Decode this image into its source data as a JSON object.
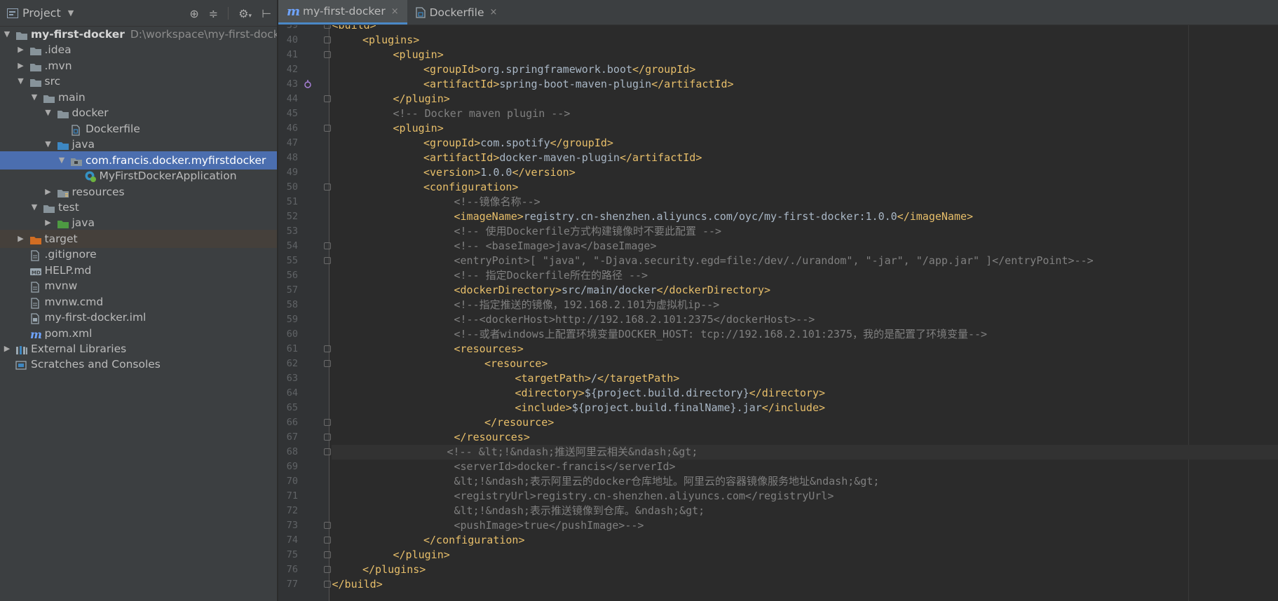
{
  "project_panel": {
    "title": "Project",
    "root_name": "my-first-docker",
    "root_path": "D:\\workspace\\my-first-docker",
    "items": [
      {
        "label": "my-first-docker",
        "depth": 0,
        "arrow": "down",
        "icon": "folder-icon"
      },
      {
        "label": ".idea",
        "depth": 1,
        "arrow": "right",
        "icon": "folder-icon"
      },
      {
        "label": ".mvn",
        "depth": 1,
        "arrow": "right",
        "icon": "folder-icon"
      },
      {
        "label": "src",
        "depth": 1,
        "arrow": "down",
        "icon": "folder-icon"
      },
      {
        "label": "main",
        "depth": 2,
        "arrow": "down",
        "icon": "folder-icon"
      },
      {
        "label": "docker",
        "depth": 3,
        "arrow": "down",
        "icon": "folder-icon"
      },
      {
        "label": "Dockerfile",
        "depth": 4,
        "arrow": "",
        "icon": "dockerfile-icon"
      },
      {
        "label": "java",
        "depth": 3,
        "arrow": "down",
        "icon": "source-folder-icon"
      },
      {
        "label": "com.francis.docker.myfirstdocker",
        "depth": 4,
        "arrow": "down",
        "icon": "package-icon"
      },
      {
        "label": "MyFirstDockerApplication",
        "depth": 5,
        "arrow": "",
        "icon": "spring-class-icon"
      },
      {
        "label": "resources",
        "depth": 3,
        "arrow": "right",
        "icon": "resources-folder-icon"
      },
      {
        "label": "test",
        "depth": 2,
        "arrow": "down",
        "icon": "folder-icon"
      },
      {
        "label": "java",
        "depth": 3,
        "arrow": "right",
        "icon": "test-folder-icon"
      },
      {
        "label": "target",
        "depth": 1,
        "arrow": "right",
        "icon": "excluded-folder-icon"
      },
      {
        "label": ".gitignore",
        "depth": 1,
        "arrow": "",
        "icon": "file-icon"
      },
      {
        "label": "HELP.md",
        "depth": 1,
        "arrow": "",
        "icon": "markdown-icon"
      },
      {
        "label": "mvnw",
        "depth": 1,
        "arrow": "",
        "icon": "file-icon"
      },
      {
        "label": "mvnw.cmd",
        "depth": 1,
        "arrow": "",
        "icon": "file-icon"
      },
      {
        "label": "my-first-docker.iml",
        "depth": 1,
        "arrow": "",
        "icon": "iml-icon"
      },
      {
        "label": "pom.xml",
        "depth": 1,
        "arrow": "",
        "icon": "maven-icon"
      },
      {
        "label": "External Libraries",
        "depth": 0,
        "arrow": "right",
        "icon": "libraries-icon"
      },
      {
        "label": "Scratches and Consoles",
        "depth": 0,
        "arrow": "",
        "icon": "scratches-icon"
      }
    ]
  },
  "editor": {
    "tabs": [
      {
        "label": "my-first-docker",
        "icon": "maven-icon",
        "active": true
      },
      {
        "label": "Dockerfile",
        "icon": "dockerfile-icon",
        "active": false
      }
    ],
    "close_glyph": "×",
    "current_line": 68,
    "lines": [
      {
        "n": 39,
        "i": 1,
        "k": "t",
        "t": "<build>"
      },
      {
        "n": 40,
        "i": 2,
        "k": "t",
        "t": "<plugins>"
      },
      {
        "n": 41,
        "i": 3,
        "k": "t",
        "t": "<plugin>"
      },
      {
        "n": 42,
        "i": 4,
        "k": "e",
        "tag": "groupId",
        "v": "org.springframework.boot"
      },
      {
        "n": 43,
        "i": 4,
        "k": "e",
        "tag": "artifactId",
        "v": "spring-boot-maven-plugin"
      },
      {
        "n": 44,
        "i": 3,
        "k": "t",
        "t": "</plugin>"
      },
      {
        "n": 45,
        "i": 3,
        "k": "c",
        "t": "<!-- Docker maven plugin -->"
      },
      {
        "n": 46,
        "i": 3,
        "k": "t",
        "t": "<plugin>"
      },
      {
        "n": 47,
        "i": 4,
        "k": "e",
        "tag": "groupId",
        "v": "com.spotify"
      },
      {
        "n": 48,
        "i": 4,
        "k": "e",
        "tag": "artifactId",
        "v": "docker-maven-plugin"
      },
      {
        "n": 49,
        "i": 4,
        "k": "e",
        "tag": "version",
        "v": "1.0.0"
      },
      {
        "n": 50,
        "i": 4,
        "k": "t",
        "t": "<configuration>"
      },
      {
        "n": 51,
        "i": 5,
        "k": "c",
        "t": "<!--镜像名称-->"
      },
      {
        "n": 52,
        "i": 5,
        "k": "e",
        "tag": "imageName",
        "v": "registry.cn-shenzhen.aliyuncs.com/oyc/my-first-docker:1.0.0"
      },
      {
        "n": 53,
        "i": 5,
        "k": "c",
        "t": "<!-- 使用Dockerfile方式构建镜像时不要此配置 -->"
      },
      {
        "n": 54,
        "i": 5,
        "k": "c",
        "t": "<!-- <baseImage>java</baseImage>"
      },
      {
        "n": 55,
        "i": 5,
        "k": "c",
        "t": "<entryPoint>[ \"java\", \"-Djava.security.egd=file:/dev/./urandom\", \"-jar\", \"/app.jar\" ]</entryPoint>-->"
      },
      {
        "n": 56,
        "i": 5,
        "k": "c",
        "t": "<!-- 指定Dockerfile所在的路径 -->"
      },
      {
        "n": 57,
        "i": 5,
        "k": "e",
        "tag": "dockerDirectory",
        "v": "src/main/docker"
      },
      {
        "n": 58,
        "i": 5,
        "k": "c",
        "t": "<!--指定推送的镜像，192.168.2.101为虚拟机ip-->"
      },
      {
        "n": 59,
        "i": 5,
        "k": "c",
        "t": "<!--<dockerHost>http://192.168.2.101:2375</dockerHost>-->"
      },
      {
        "n": 60,
        "i": 5,
        "k": "c",
        "t": "<!--或者windows上配置环境变量DOCKER_HOST: tcp://192.168.2.101:2375，我的是配置了环境变量-->"
      },
      {
        "n": 61,
        "i": 5,
        "k": "t",
        "t": "<resources>"
      },
      {
        "n": 62,
        "i": 6,
        "k": "t",
        "t": "<resource>"
      },
      {
        "n": 63,
        "i": 7,
        "k": "e",
        "tag": "targetPath",
        "v": "/"
      },
      {
        "n": 64,
        "i": 7,
        "k": "e",
        "tag": "directory",
        "v": "${project.build.directory}"
      },
      {
        "n": 65,
        "i": 7,
        "k": "e",
        "tag": "include",
        "v": "${project.build.finalName}.jar"
      },
      {
        "n": 66,
        "i": 6,
        "k": "t",
        "t": "</resource>"
      },
      {
        "n": 67,
        "i": 5,
        "k": "t",
        "t": "</resources>"
      },
      {
        "n": 68,
        "i": 5,
        "k": "c",
        "t": "<!-- &lt;!&ndash;推送阿里云相关&ndash;&gt;",
        "shift": -10
      },
      {
        "n": 69,
        "i": 5,
        "k": "c",
        "t": "<serverId>docker-francis</serverId>"
      },
      {
        "n": 70,
        "i": 5,
        "k": "c",
        "t": "&lt;!&ndash;表示阿里云的docker仓库地址。阿里云的容器镜像服务地址&ndash;&gt;"
      },
      {
        "n": 71,
        "i": 5,
        "k": "c",
        "t": "<registryUrl>registry.cn-shenzhen.aliyuncs.com</registryUrl>"
      },
      {
        "n": 72,
        "i": 5,
        "k": "c",
        "t": "&lt;!&ndash;表示推送镜像到仓库。&ndash;&gt;"
      },
      {
        "n": 73,
        "i": 5,
        "k": "c",
        "t": "<pushImage>true</pushImage>-->"
      },
      {
        "n": 74,
        "i": 4,
        "k": "t",
        "t": "</configuration>"
      },
      {
        "n": 75,
        "i": 3,
        "k": "t",
        "t": "</plugin>"
      },
      {
        "n": 76,
        "i": 2,
        "k": "t",
        "t": "</plugins>"
      },
      {
        "n": 77,
        "i": 1,
        "k": "t",
        "t": "</build>"
      }
    ],
    "fold_lines": [
      39,
      40,
      41,
      44,
      46,
      50,
      54,
      55,
      61,
      62,
      66,
      67,
      68,
      73,
      74,
      75,
      76,
      77
    ],
    "marker_line": 43
  },
  "colors": {
    "tag": "#e8bf6a",
    "comment": "#808080",
    "text": "#a9b7c6",
    "selection": "#4b6eaf",
    "folder": "#87939a",
    "source_folder": "#3d87c2",
    "test_folder": "#4d9a42",
    "excluded_folder": "#d26d22"
  }
}
